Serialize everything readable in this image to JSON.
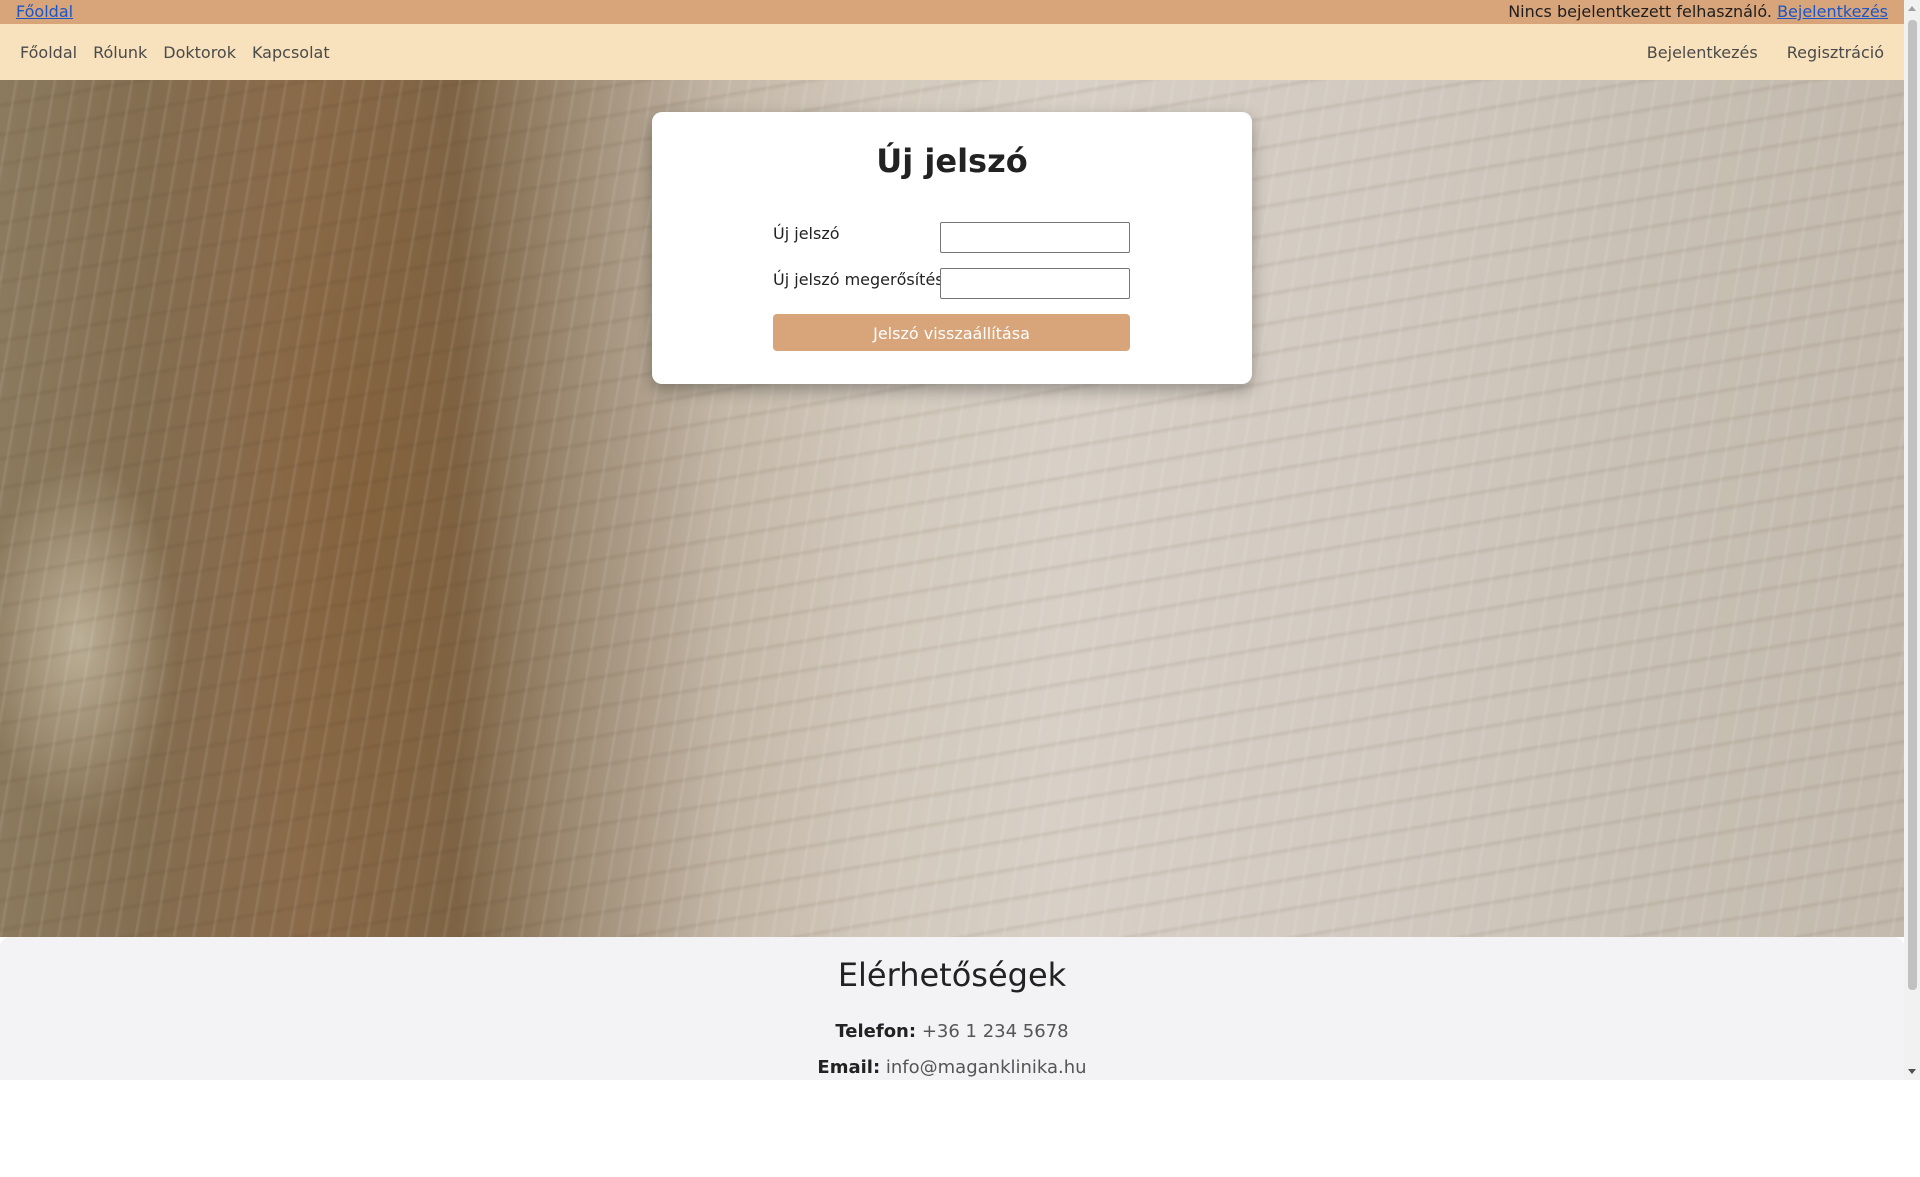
{
  "topbar": {
    "home_link": "Főoldal",
    "status_text": "Nincs bejelentkezett felhasználó.",
    "login_link": "Bejelentkezés"
  },
  "nav": {
    "left_items": [
      "Főoldal",
      "Rólunk",
      "Doktorok",
      "Kapcsolat"
    ],
    "right_items": [
      "Bejelentkezés",
      "Regisztráció"
    ]
  },
  "form": {
    "title": "Új jelszó",
    "new_password_label": "Új jelszó",
    "new_password_value": "",
    "confirm_password_label": "Új jelszó megerősítése",
    "confirm_password_value": "",
    "submit_label": "Jelszó visszaállítása"
  },
  "contact": {
    "title": "Elérhetőségek",
    "phone_label": "Telefon:",
    "phone_value": "+36 1 234 5678",
    "email_label": "Email:",
    "email_value": "info@maganklinika.hu"
  },
  "colors": {
    "topbar_bg": "#d8a47a",
    "navbar_bg": "#f8e2bd",
    "button_bg": "#d8a47a",
    "link": "#1a56c8",
    "footer_bg": "#f3f3f6"
  }
}
